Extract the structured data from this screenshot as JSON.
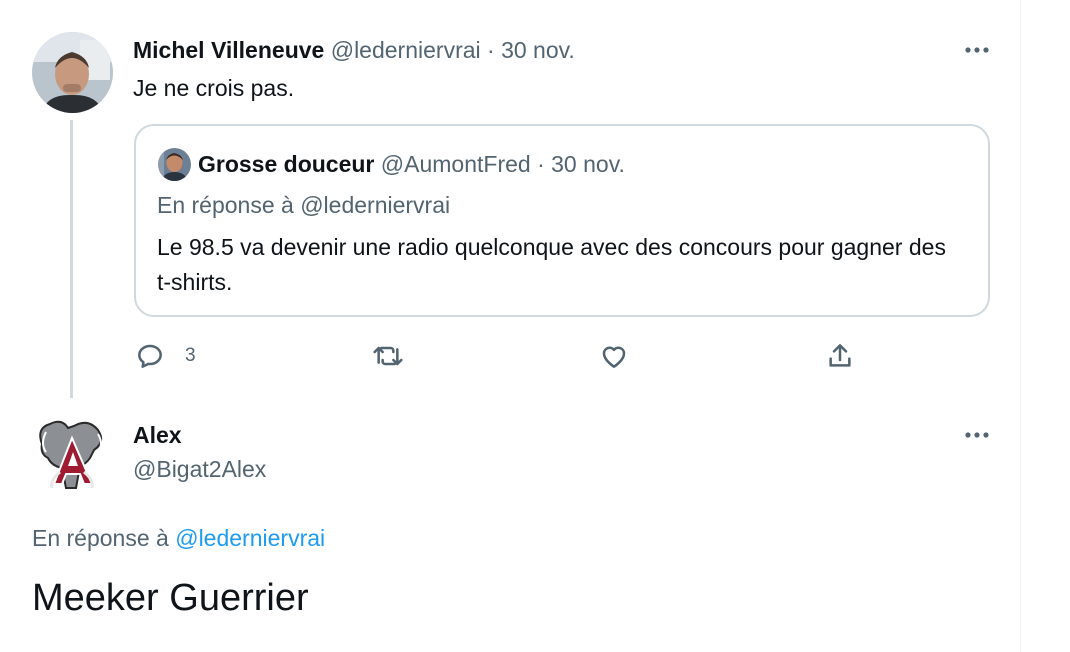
{
  "tweet1": {
    "name": "Michel Villeneuve",
    "handle": "@ledernierv­rai",
    "separator": "·",
    "date": "30 nov.",
    "text": "Je ne crois pas.",
    "quote": {
      "name": "Grosse douceur",
      "handle": "@AumontFred",
      "separator": "·",
      "date": "30 nov.",
      "reply_to": "En réponse à @ledernierv­rai",
      "text": "Le 98.5 va devenir une radio quelconque avec des concours pour gagner des t-shirts."
    },
    "actions": {
      "reply_count": "3",
      "icons": [
        "reply-icon",
        "retweet-icon",
        "like-icon",
        "share-icon"
      ]
    }
  },
  "tweet2": {
    "name": "Alex",
    "handle": "@Bigat2Alex",
    "reply_prefix": "En réponse à",
    "reply_mention": "@ledernierv­rai",
    "text": "Meeker Guerrier"
  },
  "colors": {
    "text": "#0f1419",
    "muted": "#536471",
    "link": "#1d9bf0",
    "border": "#cfd9de"
  }
}
